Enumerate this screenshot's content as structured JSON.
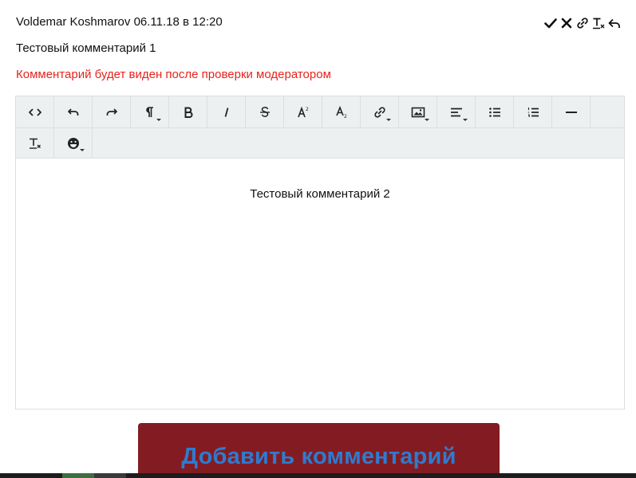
{
  "comment": {
    "author_and_date": "Voldemar Koshmarov 06.11.18 в 12:20",
    "text": "Тестовый комментарий 1",
    "moderation_note": "Комментарий будет виден после проверки модератором",
    "actions": [
      {
        "name": "approve",
        "icon": "check-icon"
      },
      {
        "name": "delete",
        "icon": "close-icon"
      },
      {
        "name": "link",
        "icon": "link-icon"
      },
      {
        "name": "clear-format",
        "icon": "clear-format-icon"
      },
      {
        "name": "reply",
        "icon": "reply-icon"
      }
    ]
  },
  "editor": {
    "toolbar_row1": [
      {
        "name": "code-view",
        "icon": "code-icon"
      },
      {
        "name": "undo",
        "icon": "undo-icon"
      },
      {
        "name": "redo",
        "icon": "redo-icon"
      },
      {
        "name": "paragraph-format",
        "icon": "paragraph-icon",
        "dropdown": true
      },
      {
        "name": "bold",
        "icon": "bold-icon"
      },
      {
        "name": "italic",
        "icon": "italic-icon"
      },
      {
        "name": "strikethrough",
        "icon": "strikethrough-icon"
      },
      {
        "name": "superscript",
        "icon": "superscript-icon"
      },
      {
        "name": "subscript",
        "icon": "subscript-icon"
      },
      {
        "name": "insert-link",
        "icon": "link-icon",
        "dropdown": true
      },
      {
        "name": "insert-image",
        "icon": "image-icon",
        "dropdown": true
      },
      {
        "name": "align",
        "icon": "align-left-icon",
        "dropdown": true
      },
      {
        "name": "unordered-list",
        "icon": "bullet-list-icon"
      },
      {
        "name": "ordered-list",
        "icon": "numbered-list-icon"
      },
      {
        "name": "horizontal-rule",
        "icon": "horizontal-rule-icon"
      }
    ],
    "toolbar_row2": [
      {
        "name": "clear-formatting",
        "icon": "clear-format-icon"
      },
      {
        "name": "emoticons",
        "icon": "emoji-icon",
        "dropdown": true
      }
    ],
    "content": "Тестовый комментарий 2"
  },
  "submit": {
    "label": "Добавить комментарий"
  },
  "colors": {
    "moderation_note": "#e8231c",
    "submit_background": "#831c22",
    "submit_text": "#2e7bcf",
    "toolbar_background": "#ecf0f1"
  }
}
